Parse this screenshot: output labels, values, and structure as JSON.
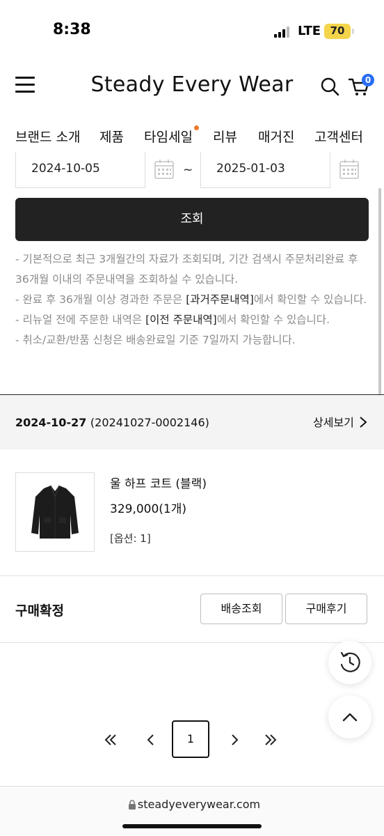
{
  "status_bar": {
    "time": "8:38",
    "network": "LTE",
    "battery": "70"
  },
  "header": {
    "title": "Steady Every Wear",
    "cart_count": "0"
  },
  "nav": {
    "items": [
      "브랜드 소개",
      "제품",
      "타임세일",
      "리뷰",
      "매거진",
      "고객센터"
    ]
  },
  "date_filter": {
    "start": "2024-10-05",
    "separator": "~",
    "end": "2025-01-03",
    "search_label": "조회"
  },
  "notes": {
    "line1": "- 기본적으로 최근 3개월간의 자료가 조회되며, 기간 검색시 주문처리완료 후 36개월 이내의 주문내역을 조회하실 수 있습니다.",
    "line2_pre": "- 완료 후 36개월 이상 경과한 주문은 ",
    "line2_link": "[과거주문내역]",
    "line2_post": "에서 확인할 수 있습니다.",
    "line3_pre": "- 리뉴얼 전에 주문한 내역은 ",
    "line3_link": "[이전 주문내역]",
    "line3_post": "에서 확인할 수 있습니다.",
    "line4": "- 취소/교환/반품 신청은 배송완료일 기준 7일까지 가능합니다."
  },
  "order": {
    "date": "2024-10-27",
    "order_no": "(20241027-0002146)",
    "detail_label": "상세보기",
    "product": {
      "name": "울 하프 코트 (블랙)",
      "price": "329,000(1개)",
      "option": "[옵션: 1]"
    },
    "status": "구매확정",
    "buttons": {
      "tracking": "배송조회",
      "review": "구매후기"
    }
  },
  "pagination": {
    "current": "1"
  },
  "browser": {
    "url": "steadyeverywear.com"
  },
  "colors": {
    "primary_button": "#222222",
    "cart_badge": "#2a6df4",
    "nav_dot": "#f07a2a",
    "battery": "#f4d44a"
  }
}
